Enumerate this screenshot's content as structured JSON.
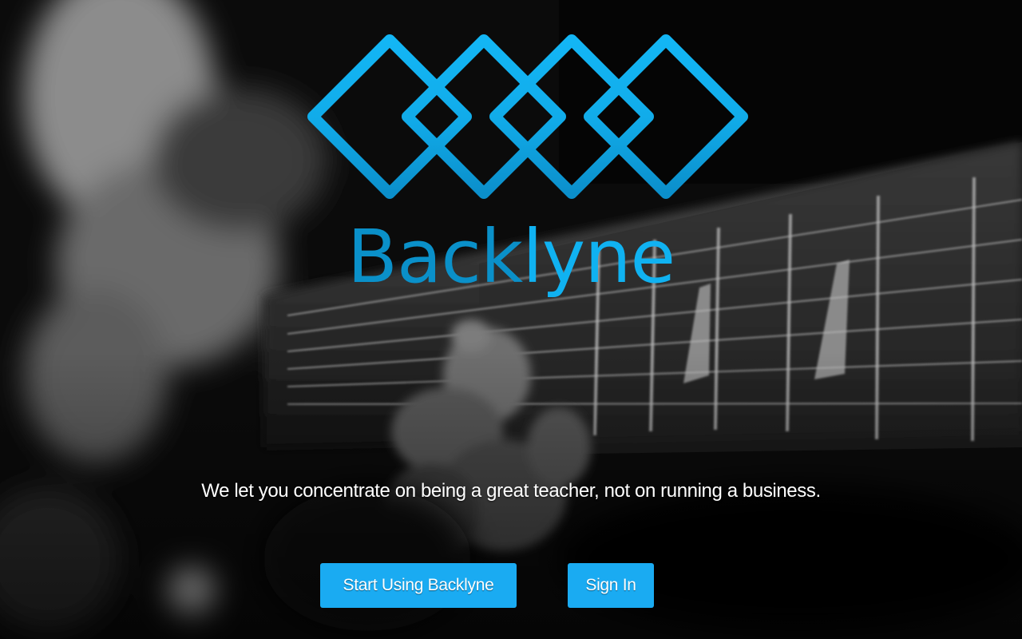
{
  "brand": {
    "name_part_1": "Back",
    "name_part_2": "lyne",
    "logo_icon": "four-interlocking-diamonds-logo",
    "color_primary": "#10b2f1",
    "color_dark": "#0a90c9"
  },
  "hero": {
    "background": "guitar-player-photo-black-and-white",
    "tagline": "We let you concentrate on being a great teacher, not on running a business."
  },
  "actions": {
    "start_label": "Start Using Backlyne",
    "signin_label": "Sign In",
    "button_color": "#1aabf2"
  }
}
